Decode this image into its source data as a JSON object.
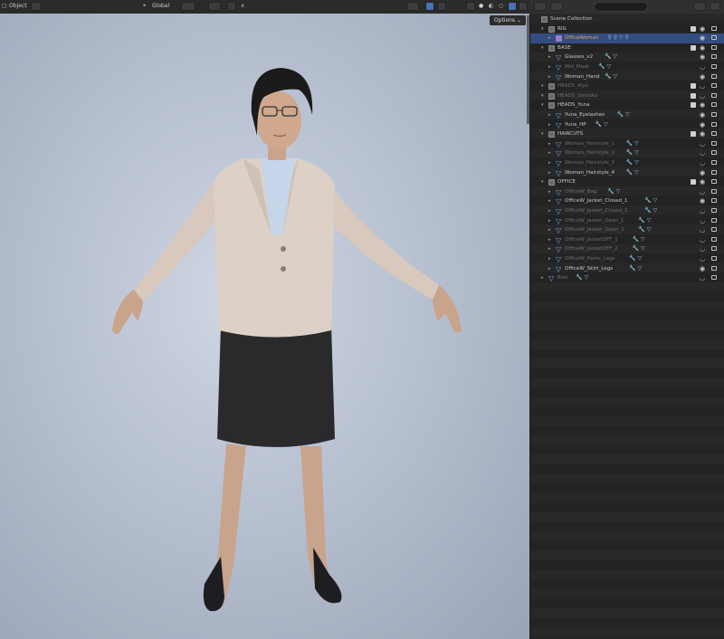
{
  "header": {
    "object_mode": "Object",
    "transform_orientation": "Global",
    "search_placeholder": ""
  },
  "viewport": {
    "options_label": "Options"
  },
  "outliner": {
    "rows": [
      {
        "label": "Scene Collection",
        "indent": 0,
        "type": "scene",
        "state": "normal"
      },
      {
        "label": "RIG",
        "indent": 1,
        "type": "collection",
        "state": "normal",
        "checkbox": true
      },
      {
        "label": "OfficeWoman",
        "indent": 2,
        "type": "armature",
        "state": "selected"
      },
      {
        "label": "BASE",
        "indent": 1,
        "type": "collection",
        "state": "normal",
        "checkbox": true
      },
      {
        "label": "Glasses_v2",
        "indent": 2,
        "type": "mesh",
        "state": "normal"
      },
      {
        "label": "Mid_Mask",
        "indent": 2,
        "type": "mesh",
        "state": "dim"
      },
      {
        "label": "Woman_Hand",
        "indent": 2,
        "type": "mesh",
        "state": "normal"
      },
      {
        "label": "HEADS_Kiyo",
        "indent": 1,
        "type": "collection",
        "state": "dim",
        "checkbox": true
      },
      {
        "label": "HEADS_Setsuko",
        "indent": 1,
        "type": "collection",
        "state": "dim",
        "checkbox": true
      },
      {
        "label": "HEADS_Yuna",
        "indent": 1,
        "type": "collection",
        "state": "normal",
        "checkbox": true
      },
      {
        "label": "Yuna_Eyelashes",
        "indent": 2,
        "type": "mesh",
        "state": "normal"
      },
      {
        "label": "Yuna_HP",
        "indent": 2,
        "type": "mesh",
        "state": "normal"
      },
      {
        "label": "HAIRCUTS",
        "indent": 1,
        "type": "collection",
        "state": "normal",
        "checkbox": true
      },
      {
        "label": "Woman_Hairstyle_1",
        "indent": 2,
        "type": "mesh",
        "state": "dim"
      },
      {
        "label": "Woman_Hairstyle_2",
        "indent": 2,
        "type": "mesh",
        "state": "dim"
      },
      {
        "label": "Woman_Hairstyle_3",
        "indent": 2,
        "type": "mesh",
        "state": "dim"
      },
      {
        "label": "Woman_Hairstyle_4",
        "indent": 2,
        "type": "mesh",
        "state": "normal"
      },
      {
        "label": "OFFICE",
        "indent": 1,
        "type": "collection",
        "state": "normal",
        "checkbox": true
      },
      {
        "label": "OfficeW_Bag",
        "indent": 2,
        "type": "mesh",
        "state": "dim"
      },
      {
        "label": "OfficeW_Jacket_Closed_1",
        "indent": 2,
        "type": "mesh",
        "state": "normal"
      },
      {
        "label": "OfficeW_Jacket_Closed_2",
        "indent": 2,
        "type": "mesh",
        "state": "dim"
      },
      {
        "label": "OfficeW_Jacket_Open_1",
        "indent": 2,
        "type": "mesh",
        "state": "dim"
      },
      {
        "label": "OfficeW_Jacket_Open_2",
        "indent": 2,
        "type": "mesh",
        "state": "dim"
      },
      {
        "label": "OfficeW_JacketOFF_1",
        "indent": 2,
        "type": "mesh",
        "state": "dim"
      },
      {
        "label": "OfficeW_JacketOFF_2",
        "indent": 2,
        "type": "mesh",
        "state": "dim"
      },
      {
        "label": "OfficeW_Pants_Legs",
        "indent": 2,
        "type": "mesh",
        "state": "dim"
      },
      {
        "label": "OfficeW_Skirt_Legs",
        "indent": 2,
        "type": "mesh",
        "state": "normal"
      },
      {
        "label": "Bod",
        "indent": 1,
        "type": "mesh",
        "state": "dim"
      }
    ]
  },
  "colors": {
    "selection": "#334d80",
    "active_object_text": "#e8a050",
    "mesh_icon": "#6fa9e6",
    "armature_icon": "#9a7bd3"
  }
}
